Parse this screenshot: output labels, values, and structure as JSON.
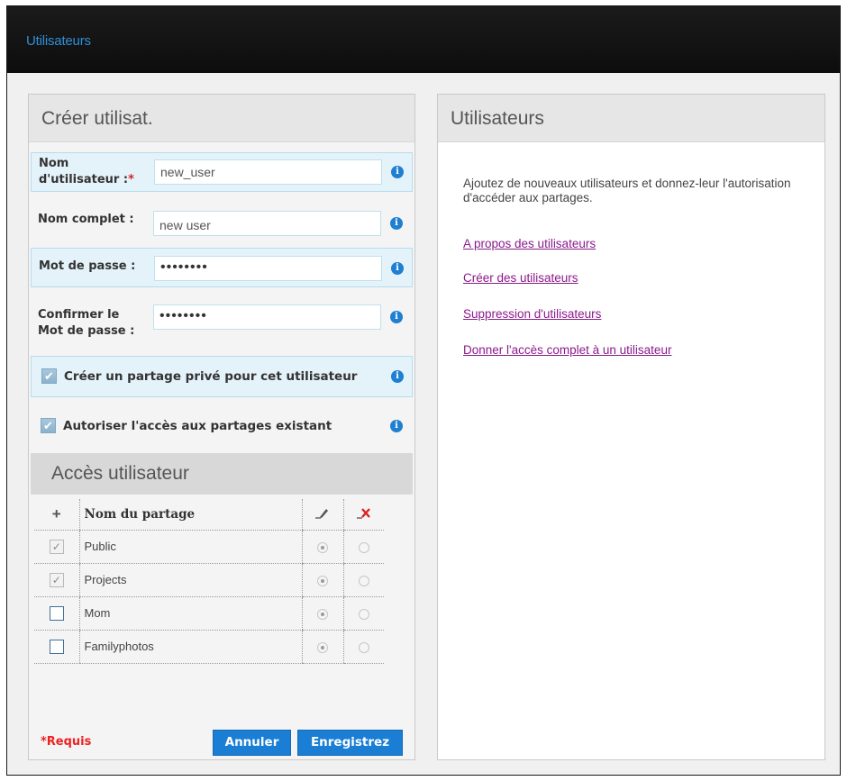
{
  "header": {
    "title": "Utilisateurs"
  },
  "create_panel": {
    "title": "Créer utilisat.",
    "fields": {
      "username": {
        "label": "Nom d'utilisateur :",
        "required_mark": "*",
        "value": "new_user"
      },
      "fullname": {
        "label": "Nom complet :",
        "value": "new user"
      },
      "password": {
        "label": "Mot de passe :",
        "value": "••••••••"
      },
      "confirm": {
        "label": "Confirmer le Mot de passe :",
        "value": "••••••••"
      }
    },
    "options": {
      "private_share": {
        "label": "Créer un partage privé pour cet utilisateur",
        "checked": true
      },
      "existing_shares": {
        "label": "Autoriser l'accès aux partages existant",
        "checked": true
      }
    },
    "access": {
      "title": "Accès utilisateur",
      "add_symbol": "+",
      "col_share": "Nom du partage",
      "rows": [
        {
          "name": "Public",
          "checked": true,
          "disabled": true,
          "read_write": true
        },
        {
          "name": "Projects",
          "checked": true,
          "disabled": true,
          "read_write": true
        },
        {
          "name": "Mom",
          "checked": false,
          "disabled": false,
          "read_write": true
        },
        {
          "name": "Familyphotos",
          "checked": false,
          "disabled": false,
          "read_write": true
        }
      ]
    },
    "required_note": "*Requis",
    "cancel_label": "Annuler",
    "save_label": "Enregistrez"
  },
  "help_panel": {
    "title": "Utilisateurs",
    "intro": "Ajoutez de nouveaux utilisateurs et donnez-leur l'autorisation d'accéder aux partages.",
    "links": [
      "A propos des utilisateurs",
      "Créer des utilisateurs",
      "Suppression d'utilisateurs",
      "Donner l'accès complet à un utilisateur"
    ]
  },
  "colors": {
    "accent": "#1a7fd4",
    "header_title": "#2f8fd8",
    "link": "#8b1a8b",
    "required": "#e22222"
  }
}
